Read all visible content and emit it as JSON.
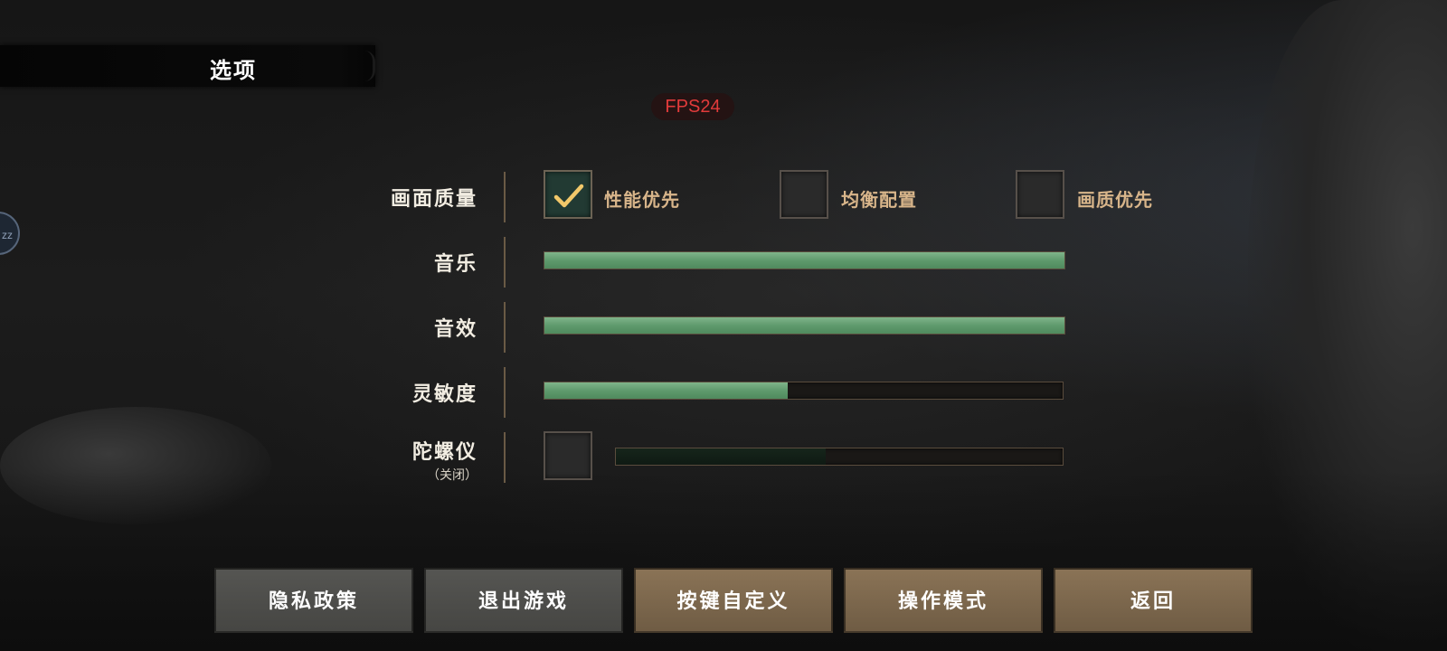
{
  "header": {
    "title": "选项"
  },
  "fps": {
    "label": "FPS24",
    "color": "#e23b3b"
  },
  "side_bubble": {
    "text": "zz"
  },
  "settings": {
    "quality": {
      "label": "画面质量",
      "options": [
        {
          "label": "性能优先",
          "checked": true
        },
        {
          "label": "均衡配置",
          "checked": false
        },
        {
          "label": "画质优先",
          "checked": false
        }
      ]
    },
    "music": {
      "label": "音乐",
      "level": 1.0
    },
    "sfx": {
      "label": "音效",
      "level": 1.0
    },
    "sensitivity": {
      "label": "灵敏度",
      "level": 0.47
    },
    "gyro": {
      "label": "陀螺仪",
      "sublabel": "（关闭）",
      "enabled": false,
      "level": 0.47
    }
  },
  "buttons": {
    "privacy": "隐私政策",
    "exit": "退出游戏",
    "keybind": "按键自定义",
    "control_mode": "操作模式",
    "back": "返回"
  },
  "colors": {
    "slider_fill": "#5f9a6d",
    "option_text": "#d8b58a",
    "button_gray": "#4e4e4b",
    "button_gold": "#7c6750"
  },
  "icons": {
    "check": "check-icon"
  }
}
